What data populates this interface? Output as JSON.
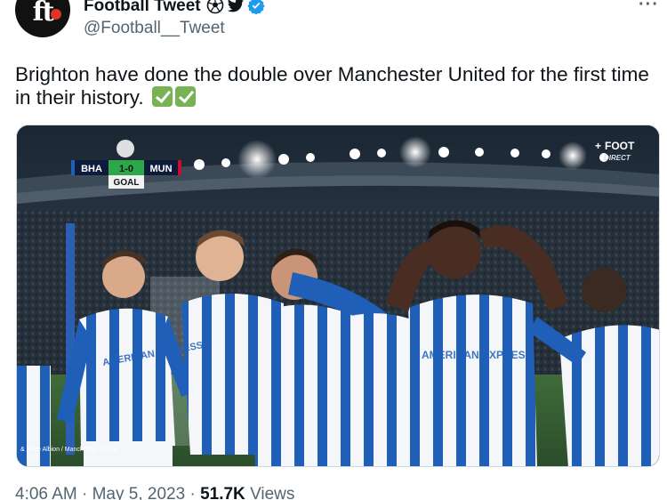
{
  "author": {
    "display_name": "Football Tweet",
    "handle": "@Football__Tweet",
    "avatar_text": "ft",
    "name_icons": [
      "soccer-ball-icon",
      "twitter-bird-icon",
      "verified-badge-icon"
    ]
  },
  "tweet": {
    "text": "Brighton have done the double over Manchester United for the first time in their history."
  },
  "media": {
    "scorebug": {
      "home": "BHA",
      "score": "1-0",
      "away": "MUN",
      "event": "GOAL"
    },
    "broadcaster": "FOOT",
    "broadcaster_sub": "DIRECT",
    "shirt_sponsor": "AMERICAN EXPRESS",
    "caption": "& Hove Albion / Manchester United"
  },
  "meta": {
    "time": "4:06 AM",
    "date": "May 5, 2023",
    "views_count": "51.7K",
    "views_label": "Views"
  },
  "colors": {
    "verified": "#1d9bf0",
    "check_green": "#77b255",
    "brighton_blue": "#1f5fb8",
    "scorebug_green": "#2ca84a"
  }
}
